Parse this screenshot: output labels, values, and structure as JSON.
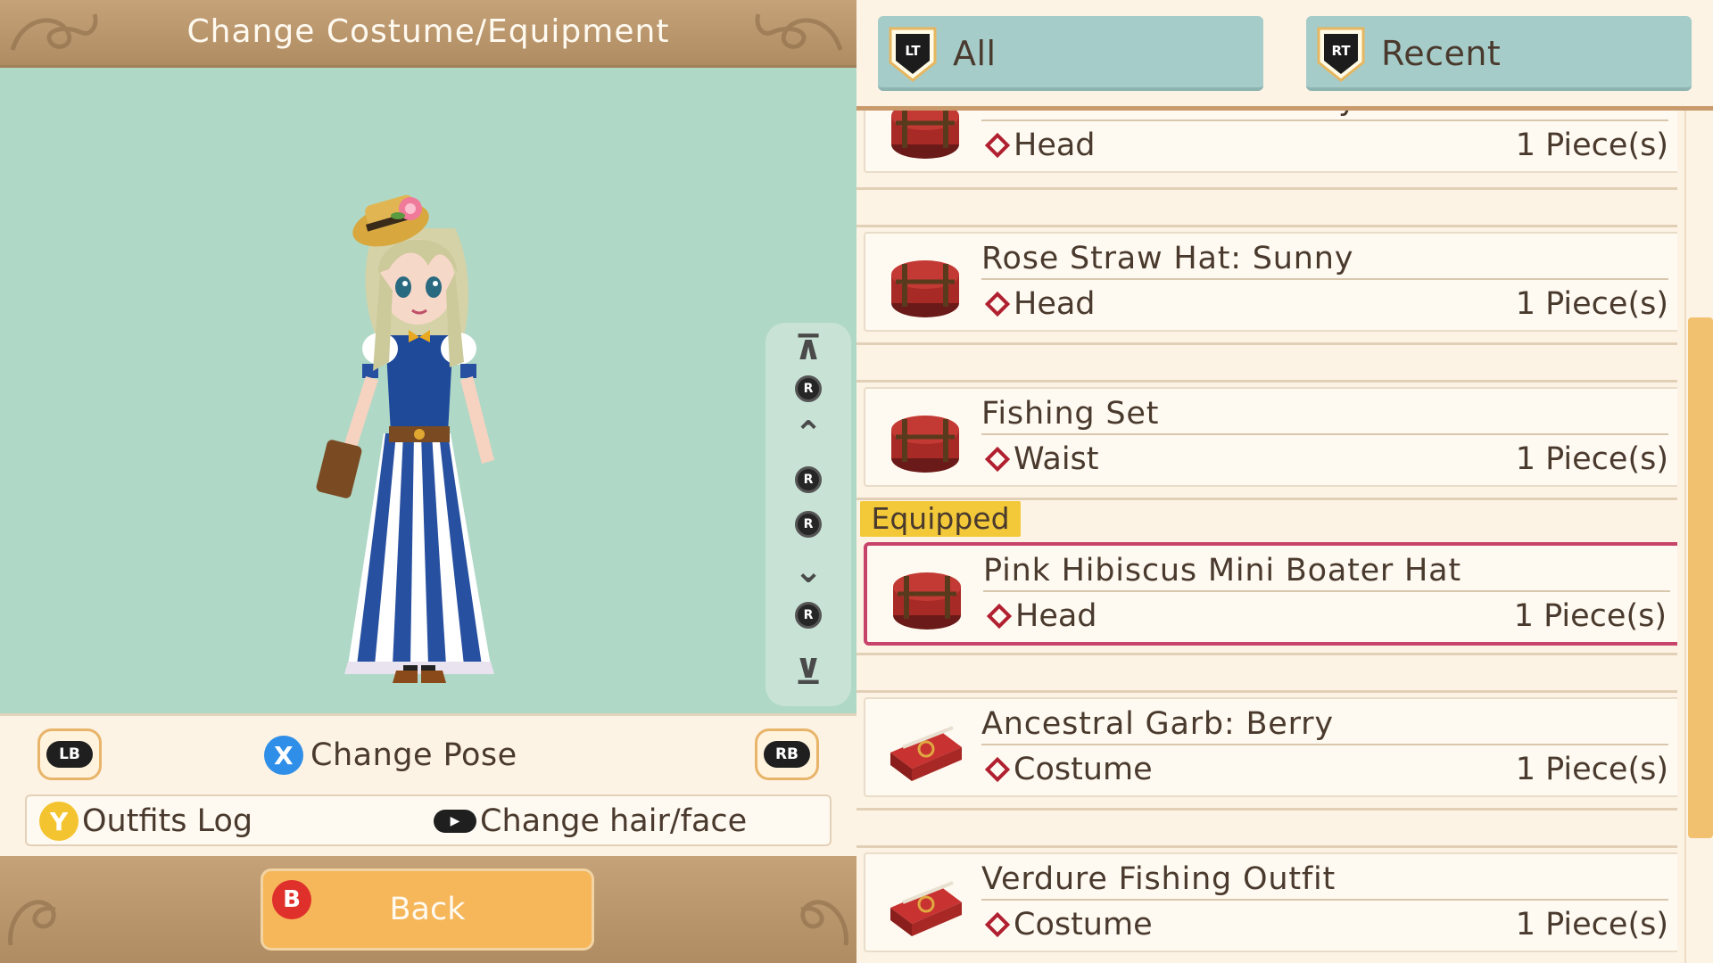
{
  "header": {
    "title": "Change Costume/Equipment"
  },
  "viewer": {
    "rotate": {
      "stick_label": "R"
    }
  },
  "controls": {
    "lb_label": "LB",
    "rb_label": "RB",
    "pose_button": "X",
    "pose_label": "Change Pose",
    "outfits_button": "Y",
    "outfits_label": "Outfits Log",
    "hair_label": "Change hair/face"
  },
  "footer": {
    "back_button": "B",
    "back_label": "Back"
  },
  "filters": {
    "all": {
      "button": "LT",
      "label": "All"
    },
    "recent": {
      "button": "RT",
      "label": "Recent"
    }
  },
  "items": [
    {
      "name": "Rose Straw Hat: Lovely",
      "slot": "Head",
      "qty": "1 Piece(s)",
      "icon": "hat-box-icon"
    },
    {
      "name": "Rose Straw Hat: Sunny",
      "slot": "Head",
      "qty": "1 Piece(s)",
      "icon": "hat-box-icon"
    },
    {
      "name": "Fishing Set",
      "slot": "Waist",
      "qty": "1 Piece(s)",
      "icon": "hat-box-icon"
    },
    {
      "name": "Pink Hibiscus Mini Boater Hat",
      "slot": "Head",
      "qty": "1 Piece(s)",
      "icon": "hat-box-icon"
    },
    {
      "name": "Ancestral Garb: Berry",
      "slot": "Costume",
      "qty": "1 Piece(s)",
      "icon": "costume-case-icon"
    },
    {
      "name": "Verdure Fishing Outfit",
      "slot": "Costume",
      "qty": "1 Piece(s)",
      "icon": "costume-case-icon"
    }
  ],
  "equipped_label": "Equipped",
  "colors": {
    "viewport": "#b0d8c6",
    "title_bar": "#b8956b",
    "tab": "#a6ccc9",
    "equipped_border": "#c8436a",
    "equipped_tag": "#f3c93a",
    "back_button": "#f6b65a"
  }
}
